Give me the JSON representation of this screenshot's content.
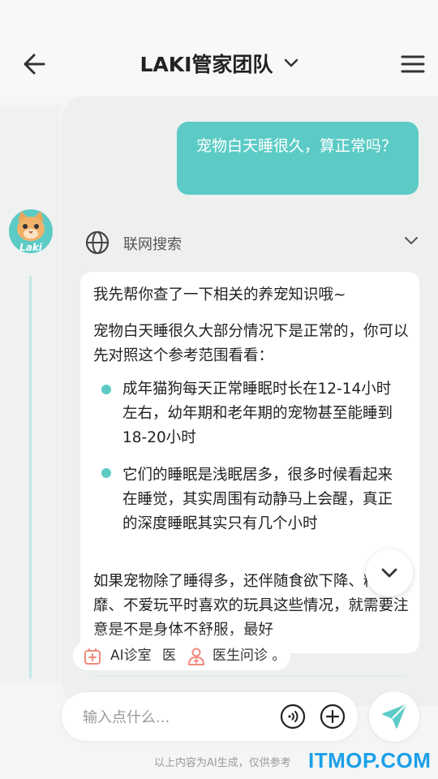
{
  "header": {
    "title": "LAKI管家团队",
    "back_icon": "arrow-left-icon",
    "menu_icon": "hamburger-menu-icon"
  },
  "avatar": {
    "brand": "Laki"
  },
  "chat": {
    "user_message": "宠物白天睡很久，算正常吗？",
    "search_label": "联网搜索",
    "ai_message": {
      "intro": "我先帮你查了一下相关的养宠知识哦~",
      "paragraph": "宠物白天睡很久大部分情况下是正常的，你可以先对照这个参考范围看看：",
      "bullets": [
        "成年猫狗每天正常睡眠时长在12-14小时左右，幼年期和老年期的宠物甚至能睡到18-20小时",
        "它们的睡眠是浅眠居多，很多时候看起来在睡觉，其实周围有动静马上会醒，真正的深度睡眠其实只有几个小时"
      ],
      "closing": "如果宠物除了睡得多，还伴随食欲下降、精神萎靡、不爱玩平时喜欢的玩具这些情况，就需要注意是不是身体不舒服，最好"
    }
  },
  "quick_actions": {
    "ai_clinic": "AI诊室",
    "ai_clinic_extra": "医",
    "doctor_consult": "医生问诊",
    "doctor_consult_extra": "。"
  },
  "input": {
    "placeholder": "输入点什么..."
  },
  "footer": {
    "disclaimer": "以上内容为AI生成，仅供参考",
    "watermark": "ITMOP.COM"
  },
  "colors": {
    "accent": "#5ccbc5",
    "background": "#f4f5f5",
    "watermark": "#1aa0e8"
  }
}
